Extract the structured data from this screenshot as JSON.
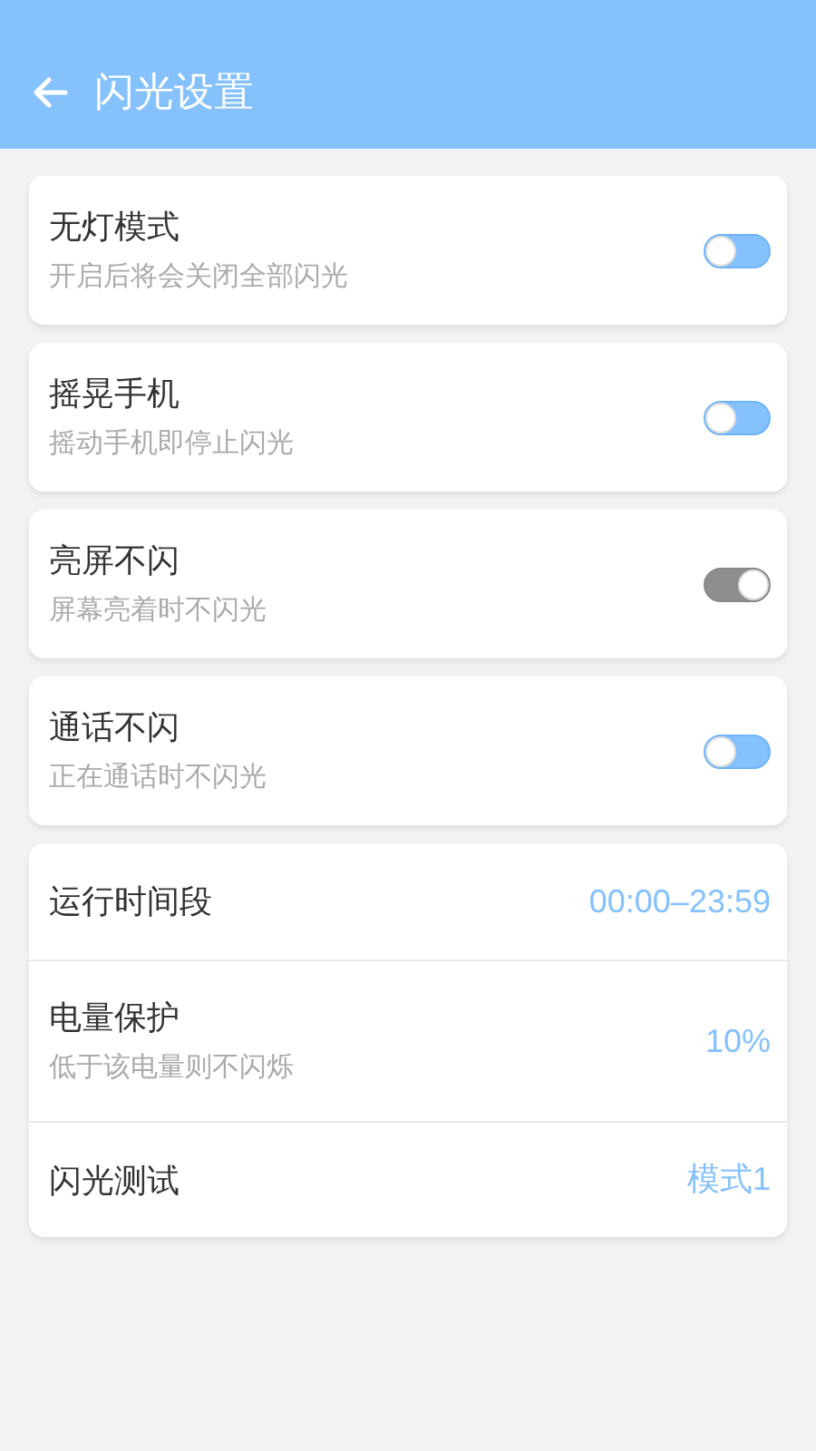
{
  "header": {
    "title": "闪光设置"
  },
  "toggles": [
    {
      "title": "无灯模式",
      "subtitle": "开启后将会关闭全部闪光",
      "on": false
    },
    {
      "title": "摇晃手机",
      "subtitle": "摇动手机即停止闪光",
      "on": false
    },
    {
      "title": "亮屏不闪",
      "subtitle": "屏幕亮着时不闪光",
      "on": true
    },
    {
      "title": "通话不闪",
      "subtitle": "正在通话时不闪光",
      "on": false
    }
  ],
  "settings": [
    {
      "title": "运行时间段",
      "value": "00:00–23:59"
    },
    {
      "title": "电量保护",
      "subtitle": "低于该电量则不闪烁",
      "value": "10%"
    },
    {
      "title": "闪光测试",
      "value": "模式1"
    }
  ]
}
